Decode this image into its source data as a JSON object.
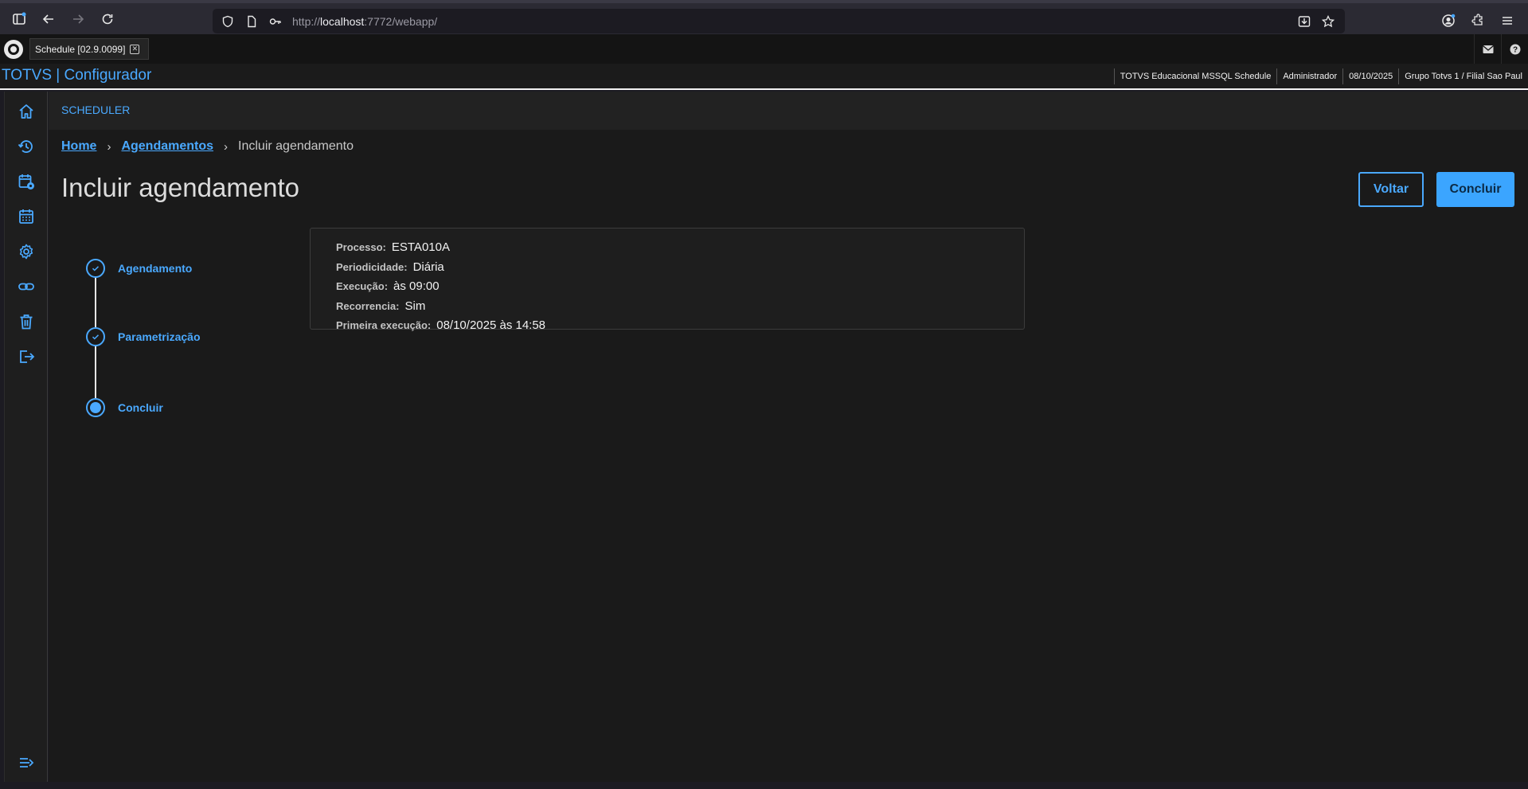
{
  "browser": {
    "url_prefix": "http://",
    "url_host": "localhost",
    "url_rest": ":7772/webapp/"
  },
  "tab": {
    "title": "Schedule [02.9.0099]",
    "close_glyph": "✕"
  },
  "app": {
    "brand": "TOTVS | Configurador",
    "status": [
      "TOTVS Educacional MSSQL Schedule",
      "Administrador",
      "08/10/2025",
      "Grupo Totvs 1 / Filial Sao Paul"
    ]
  },
  "sidebar": {
    "icons": [
      "home-icon",
      "history-icon",
      "calendar-settings-icon",
      "calendar-icon",
      "gear-icon",
      "link-icon",
      "trash-icon",
      "logout-icon",
      "menu-expand-icon"
    ]
  },
  "page": {
    "section": "SCHEDULER",
    "breadcrumb": {
      "home": "Home",
      "agendamentos": "Agendamentos",
      "current": "Incluir agendamento",
      "sep": "›"
    },
    "title": "Incluir agendamento",
    "buttons": {
      "back": "Voltar",
      "done": "Concluir"
    }
  },
  "stepper": {
    "steps": [
      {
        "label": "Agendamento",
        "state": "done"
      },
      {
        "label": "Parametrização",
        "state": "done"
      },
      {
        "label": "Concluir",
        "state": "active"
      }
    ]
  },
  "summary": {
    "rows": [
      {
        "key": "Processo:",
        "value": "ESTA010A"
      },
      {
        "key": "Periodicidade:",
        "value": "Diária"
      },
      {
        "key": "Execução:",
        "value": "às 09:00"
      },
      {
        "key": "Recorrencia:",
        "value": "Sim"
      },
      {
        "key": "Primeira execução:",
        "value": "08/10/2025 às 14:58"
      }
    ]
  },
  "colors": {
    "accent": "#4aa9ff",
    "background": "#1a1a1a"
  }
}
